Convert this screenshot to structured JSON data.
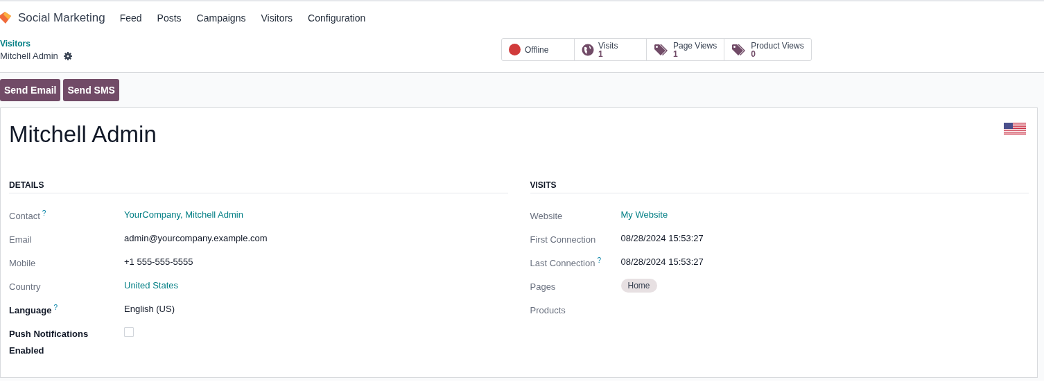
{
  "navbar": {
    "app_name": "Social Marketing",
    "menu": [
      "Feed",
      "Posts",
      "Campaigns",
      "Visitors",
      "Configuration"
    ]
  },
  "breadcrumb": {
    "parent": "Visitors",
    "current": "Mitchell Admin"
  },
  "stat_buttons": [
    {
      "kind": "status",
      "label": "Offline",
      "color": "#d13b3b"
    },
    {
      "kind": "globe",
      "label": "Visits",
      "value": "1"
    },
    {
      "kind": "tag",
      "label": "Page Views",
      "value": "1"
    },
    {
      "kind": "tag",
      "label": "Product Views",
      "value": "0"
    }
  ],
  "actions": [
    "Send Email",
    "Send SMS"
  ],
  "record": {
    "title": "Mitchell Admin",
    "details": {
      "heading": "DETAILS",
      "fields": [
        {
          "label": "Contact",
          "help": "?",
          "bold": false,
          "kind": "link",
          "value": "YourCompany, Mitchell Admin"
        },
        {
          "label": "Email",
          "bold": false,
          "kind": "text",
          "value": "admin@yourcompany.example.com"
        },
        {
          "label": "Mobile",
          "bold": false,
          "kind": "text",
          "value": "+1 555-555-5555"
        },
        {
          "label": "Country",
          "bold": false,
          "kind": "link",
          "value": "United States"
        },
        {
          "label": "Language",
          "help": "?",
          "bold": true,
          "kind": "text",
          "value": "English (US)"
        },
        {
          "label": "Push Notifications Enabled",
          "bold": true,
          "kind": "checkbox",
          "checked": false
        }
      ]
    },
    "visits": {
      "heading": "VISITS",
      "fields": [
        {
          "label": "Website",
          "bold": false,
          "kind": "link",
          "value": "My Website"
        },
        {
          "label": "First Connection",
          "bold": false,
          "kind": "text",
          "value": "08/28/2024 15:53:27"
        },
        {
          "label": "Last Connection",
          "help": "?",
          "bold": false,
          "kind": "text",
          "value": "08/28/2024 15:53:27"
        },
        {
          "label": "Pages",
          "bold": false,
          "kind": "tags",
          "tags": [
            "Home"
          ]
        },
        {
          "label": "Products",
          "bold": false,
          "kind": "tags"
        }
      ]
    }
  }
}
